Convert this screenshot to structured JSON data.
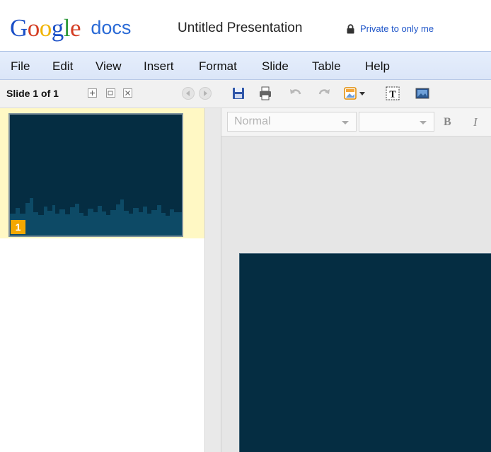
{
  "app": {
    "logo_letters": [
      {
        "ch": "G",
        "color": "#1a4fc7"
      },
      {
        "ch": "o",
        "color": "#d43d23"
      },
      {
        "ch": "o",
        "color": "#f0b400"
      },
      {
        "ch": "g",
        "color": "#1a4fc7"
      },
      {
        "ch": "l",
        "color": "#2f9a3b"
      },
      {
        "ch": "e",
        "color": "#d43d23"
      }
    ],
    "logo_suffix": "docs",
    "doc_title": "Untitled Presentation",
    "privacy_text": "Private to only me"
  },
  "menu": {
    "items": [
      "File",
      "Edit",
      "View",
      "Insert",
      "Format",
      "Slide",
      "Table",
      "Help"
    ]
  },
  "sidebar": {
    "slide_count": "Slide 1 of 1",
    "buttons": [
      "add-slide-icon",
      "duplicate-slide-icon",
      "delete-slide-icon"
    ],
    "slides": [
      {
        "number": "1",
        "selected": true
      }
    ]
  },
  "toolbar": {
    "icons": [
      "save-icon",
      "print-icon",
      "undo-icon",
      "redo-icon",
      "theme-icon",
      "textbox-icon",
      "image-icon"
    ]
  },
  "formatbar": {
    "style_value": "Normal",
    "size_value": "",
    "bold_label": "B",
    "italic_label": "I"
  },
  "colors": {
    "slide_background": "#052d42",
    "selected_row": "#fff8c4",
    "slide_number_badge": "#f4a800",
    "menubar": "#dbe6f8"
  }
}
